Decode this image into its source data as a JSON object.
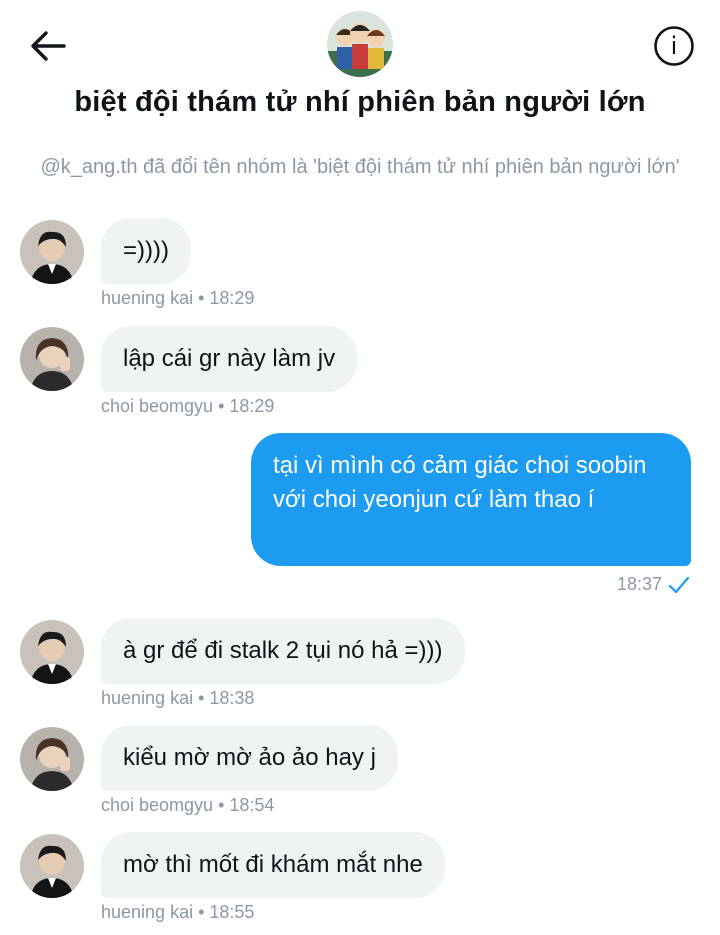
{
  "header": {
    "title": "biệt đội thám tử nhí phiên bản người lớn",
    "back_icon": "arrow-left-icon",
    "info_icon": "info-icon",
    "info_glyph": "i"
  },
  "system_message": "@k_ang.th đã đổi tên nhóm là 'biệt đội thám tử nhí phiên bản người lớn'",
  "messages": [
    {
      "text": "=))))",
      "sender": "huening kai",
      "time": "18:29",
      "meta": "huening kai • 18:29"
    },
    {
      "text": "lập cái gr này làm jv",
      "sender": "choi beomgyu",
      "time": "18:29",
      "meta": "choi beomgyu • 18:29"
    },
    {
      "text": "tại vì mình có cảm giác choi soobin với choi yeonjun cứ làm thao í",
      "outgoing": true,
      "time": "18:37",
      "status_icon": "checkmark-icon"
    },
    {
      "text": "à gr để đi stalk 2 tụi nó hả =)))",
      "sender": "huening kai",
      "time": "18:38",
      "meta": "huening kai • 18:38"
    },
    {
      "text": "kiểu mờ mờ ảo ảo hay j",
      "sender": "choi beomgyu",
      "time": "18:54",
      "meta": "choi beomgyu • 18:54"
    },
    {
      "text": "mờ thì mốt đi khám mắt nhe",
      "sender": "huening kai",
      "time": "18:55",
      "meta": "huening kai • 18:55"
    }
  ],
  "colors": {
    "accent": "#1d9bf0",
    "incoming_bubble": "#eff3f4",
    "meta_text": "#8b98a5"
  }
}
